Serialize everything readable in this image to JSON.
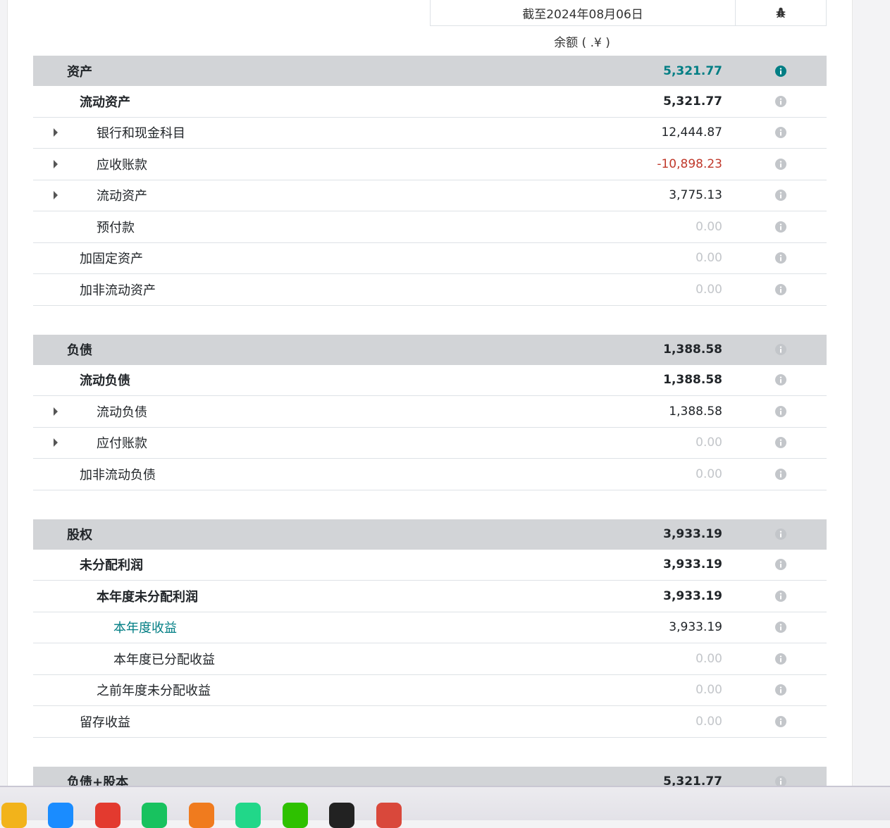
{
  "header": {
    "date_label": "截至2024年08月06日",
    "balance_label": "余额 ( .¥ )",
    "debug_icon": "bug-icon"
  },
  "rows": [
    {
      "label": "资产",
      "value": "5,321.77",
      "type": "section",
      "indent": 48,
      "value_color": "#017e84",
      "info_color": "#017e84"
    },
    {
      "label": "流动资产",
      "value": "5,321.77",
      "type": "bold",
      "indent": 66
    },
    {
      "label": "银行和现金科目",
      "value": "12,444.87",
      "type": "normal",
      "indent": 90,
      "expandable": true
    },
    {
      "label": "应收账款",
      "value": "-10,898.23",
      "type": "normal",
      "indent": 90,
      "expandable": true,
      "value_style": "neg"
    },
    {
      "label": "流动资产",
      "value": "3,775.13",
      "type": "normal",
      "indent": 90,
      "expandable": true
    },
    {
      "label": "预付款",
      "value": "0.00",
      "type": "normal",
      "indent": 90,
      "value_style": "muted"
    },
    {
      "label": "加固定资产",
      "value": "0.00",
      "type": "normal",
      "indent": 66,
      "value_style": "muted"
    },
    {
      "label": "加非流动资产",
      "value": "0.00",
      "type": "normal",
      "indent": 66,
      "value_style": "muted"
    },
    {
      "type": "gap"
    },
    {
      "label": "负债",
      "value": "1,388.58",
      "type": "section",
      "indent": 48
    },
    {
      "label": "流动负债",
      "value": "1,388.58",
      "type": "bold",
      "indent": 66
    },
    {
      "label": "流动负债",
      "value": "1,388.58",
      "type": "normal",
      "indent": 90,
      "expandable": true
    },
    {
      "label": "应付账款",
      "value": "0.00",
      "type": "normal",
      "indent": 90,
      "expandable": true,
      "value_style": "muted"
    },
    {
      "label": "加非流动负债",
      "value": "0.00",
      "type": "normal",
      "indent": 66,
      "value_style": "muted"
    },
    {
      "type": "gap"
    },
    {
      "label": "股权",
      "value": "3,933.19",
      "type": "section",
      "indent": 48
    },
    {
      "label": "未分配利润",
      "value": "3,933.19",
      "type": "bold",
      "indent": 66
    },
    {
      "label": "本年度未分配利润",
      "value": "3,933.19",
      "type": "bold",
      "indent": 90
    },
    {
      "label": "本年度收益",
      "value": "3,933.19",
      "type": "normal",
      "indent": 114,
      "label_style": "teal"
    },
    {
      "label": "本年度已分配收益",
      "value": "0.00",
      "type": "normal",
      "indent": 114,
      "value_style": "muted"
    },
    {
      "label": "之前年度未分配收益",
      "value": "0.00",
      "type": "normal",
      "indent": 90,
      "value_style": "muted"
    },
    {
      "label": "留存收益",
      "value": "0.00",
      "type": "normal",
      "indent": 66,
      "value_style": "muted"
    },
    {
      "type": "gap"
    },
    {
      "label": "负债+股本",
      "value": "5,321.77",
      "type": "section",
      "indent": 48
    }
  ],
  "taskbar": {
    "apps": [
      {
        "name": "folder-icon",
        "color": "#f2b31b"
      },
      {
        "name": "kugou-icon",
        "color": "#1a8cff"
      },
      {
        "name": "wps-icon",
        "color": "#e33a2f"
      },
      {
        "name": "wechat-work-icon",
        "color": "#18c25f"
      },
      {
        "name": "git-icon",
        "color": "#f07b1e"
      },
      {
        "name": "pycharm-icon",
        "color": "#21d789"
      },
      {
        "name": "wechat-icon",
        "color": "#2ec100"
      },
      {
        "name": "qq-icon",
        "color": "#222222"
      },
      {
        "name": "app-icon",
        "color": "#d9483b"
      }
    ]
  }
}
